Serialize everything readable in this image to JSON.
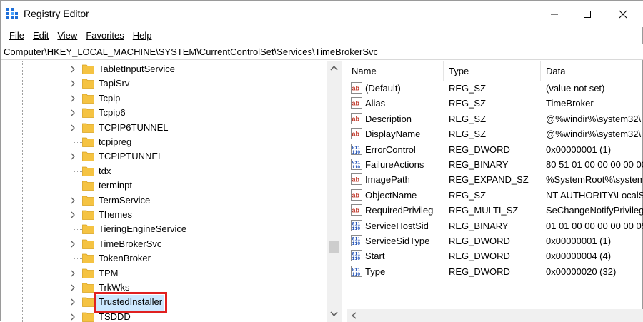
{
  "window": {
    "title": "Registry Editor"
  },
  "menu": [
    "File",
    "Edit",
    "View",
    "Favorites",
    "Help"
  ],
  "address": "Computer\\HKEY_LOCAL_MACHINE\\SYSTEM\\CurrentControlSet\\Services\\TimeBrokerSvc",
  "tree": [
    {
      "label": "TabletInputService",
      "expandable": true
    },
    {
      "label": "TapiSrv",
      "expandable": true
    },
    {
      "label": "Tcpip",
      "expandable": true
    },
    {
      "label": "Tcpip6",
      "expandable": true
    },
    {
      "label": "TCPIP6TUNNEL",
      "expandable": true
    },
    {
      "label": "tcpipreg",
      "expandable": false
    },
    {
      "label": "TCPIPTUNNEL",
      "expandable": true
    },
    {
      "label": "tdx",
      "expandable": false
    },
    {
      "label": "terminpt",
      "expandable": false
    },
    {
      "label": "TermService",
      "expandable": true
    },
    {
      "label": "Themes",
      "expandable": true
    },
    {
      "label": "TieringEngineService",
      "expandable": false
    },
    {
      "label": "TimeBrokerSvc",
      "expandable": true,
      "selected": true
    },
    {
      "label": "TokenBroker",
      "expandable": false
    },
    {
      "label": "TPM",
      "expandable": true
    },
    {
      "label": "TrkWks",
      "expandable": true
    },
    {
      "label": "TrustedInstaller",
      "expandable": true
    },
    {
      "label": "TSDDD",
      "expandable": true
    }
  ],
  "columns": {
    "name": "Name",
    "type": "Type",
    "data": "Data"
  },
  "values": [
    {
      "icon": "string-value-icon",
      "name": "(Default)",
      "type": "REG_SZ",
      "data": "(value not set)"
    },
    {
      "icon": "string-value-icon",
      "name": "Alias",
      "type": "REG_SZ",
      "data": "TimeBroker"
    },
    {
      "icon": "string-value-icon",
      "name": "Description",
      "type": "REG_SZ",
      "data": "@%windir%\\system32\\"
    },
    {
      "icon": "string-value-icon",
      "name": "DisplayName",
      "type": "REG_SZ",
      "data": "@%windir%\\system32\\"
    },
    {
      "icon": "binary-value-icon",
      "name": "ErrorControl",
      "type": "REG_DWORD",
      "data": "0x00000001 (1)"
    },
    {
      "icon": "binary-value-icon",
      "name": "FailureActions",
      "type": "REG_BINARY",
      "data": "80 51 01 00 00 00 00 00"
    },
    {
      "icon": "string-value-icon",
      "name": "ImagePath",
      "type": "REG_EXPAND_SZ",
      "data": "%SystemRoot%\\system"
    },
    {
      "icon": "string-value-icon",
      "name": "ObjectName",
      "type": "REG_SZ",
      "data": "NT AUTHORITY\\LocalS"
    },
    {
      "icon": "string-value-icon",
      "name": "RequiredPrivileg",
      "type": "REG_MULTI_SZ",
      "data": "SeChangeNotifyPrivileg"
    },
    {
      "icon": "binary-value-icon",
      "name": "ServiceHostSid",
      "type": "REG_BINARY",
      "data": "01 01 00 00 00 00 00 05"
    },
    {
      "icon": "binary-value-icon",
      "name": "ServiceSidType",
      "type": "REG_DWORD",
      "data": "0x00000001 (1)"
    },
    {
      "icon": "binary-value-icon",
      "name": "Start",
      "type": "REG_DWORD",
      "data": "0x00000004 (4)"
    },
    {
      "icon": "binary-value-icon",
      "name": "Type",
      "type": "REG_DWORD",
      "data": "0x00000020 (32)"
    }
  ],
  "colors": {
    "selection": "#cce8ff",
    "highlight_box": "#e02020",
    "folder": "#f5c342"
  }
}
